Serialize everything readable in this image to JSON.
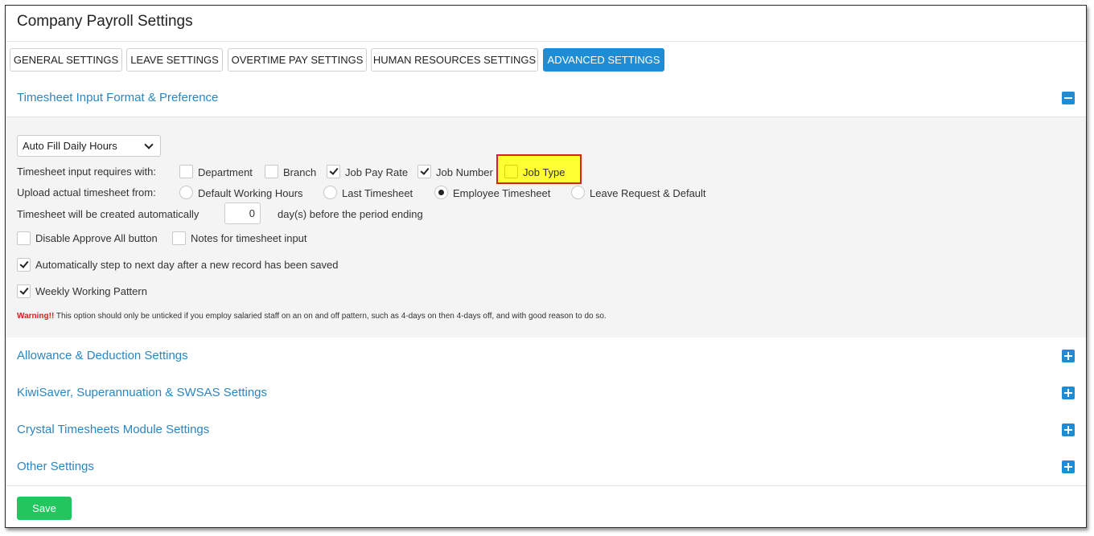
{
  "page": {
    "title": "Company Payroll Settings"
  },
  "tabs": [
    {
      "label": "GENERAL SETTINGS",
      "active": false
    },
    {
      "label": "LEAVE SETTINGS",
      "active": false
    },
    {
      "label": "OVERTIME PAY SETTINGS",
      "active": false
    },
    {
      "label": "HUMAN RESOURCES SETTINGS",
      "active": false
    },
    {
      "label": "ADVANCED SETTINGS",
      "active": true
    }
  ],
  "timesheet_section": {
    "title": "Timesheet Input Format & Preference",
    "expanded": true,
    "fill_select": {
      "value": "Auto Fill Daily Hours"
    },
    "requires_label": "Timesheet input requires with:",
    "requires_options": [
      {
        "label": "Department",
        "checked": false
      },
      {
        "label": "Branch",
        "checked": false
      },
      {
        "label": "Job Pay Rate",
        "checked": true
      },
      {
        "label": "Job Number",
        "checked": true
      },
      {
        "label": "Job Type",
        "checked": false,
        "highlighted": true
      }
    ],
    "upload_label": "Upload actual timesheet from:",
    "upload_options": [
      {
        "label": "Default Working Hours",
        "selected": false
      },
      {
        "label": "Last Timesheet",
        "selected": false
      },
      {
        "label": "Employee Timesheet",
        "selected": true
      },
      {
        "label": "Leave Request & Default",
        "selected": false
      }
    ],
    "auto_create_label": "Timesheet will be created automatically",
    "auto_create_days": "0",
    "auto_create_suffix": "day(s) before the period ending",
    "disable_approve": {
      "label": "Disable Approve All button",
      "checked": false
    },
    "notes_input": {
      "label": "Notes for timesheet input",
      "checked": false
    },
    "auto_step": {
      "label": "Automatically step to next day after a new record has been saved",
      "checked": true
    },
    "weekly_pattern": {
      "label": "Weekly Working Pattern",
      "checked": true
    },
    "warning_prefix": "Warning!!",
    "warning_text": "This option should only be unticked if you employ salaried staff on an on and off pattern, such as 4-days on then 4-days off, and with good reason to do so."
  },
  "collapsed_sections": [
    {
      "title": "Allowance & Deduction Settings"
    },
    {
      "title": "KiwiSaver, Superannuation & SWSAS Settings"
    },
    {
      "title": "Crystal Timesheets Module Settings"
    },
    {
      "title": "Other Settings"
    }
  ],
  "save_label": "Save",
  "colors": {
    "accent": "#1f8dd6",
    "section_title": "#2a86c2",
    "save": "#22c55e",
    "warning": "#e01b1b",
    "highlight": "#ffff33",
    "highlight_border": "#d82020"
  },
  "icons": {
    "collapse": "minus-square-icon",
    "expand": "plus-square-icon",
    "dropdown": "chevron-down-icon",
    "check": "check-icon"
  }
}
